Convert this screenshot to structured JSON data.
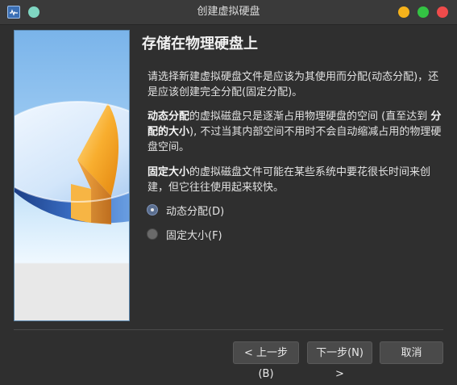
{
  "window": {
    "title": "创建虚拟硬盘"
  },
  "page": {
    "heading": "存储在物理硬盘上",
    "paragraph1": "请选择新建虚拟硬盘文件是应该为其使用而分配(动态分配)，还是应该创建完全分配(固定分配)。",
    "paragraph2": {
      "bold1": "动态分配",
      "text1": "的虚拟磁盘只是逐渐占用物理硬盘的空间 (直至达到 ",
      "bold2": "分配的大小",
      "text2": "), 不过当其内部空间不用时不会自动缩减占用的物理硬盘空间。"
    },
    "paragraph3": {
      "bold1": "固定大小",
      "text1": "的虚拟磁盘文件可能在某些系统中要花很长时间来创建，但它往往使用起来较快。"
    },
    "options": [
      {
        "label": "动态分配(D)",
        "selected": true
      },
      {
        "label": "固定大小(F)",
        "selected": false
      }
    ]
  },
  "buttons": {
    "back": "< 上一步(B)",
    "next": "下一步(N) >",
    "cancel": "取消"
  },
  "colors": {
    "window_bg": "#2f2f2f",
    "titlebar_bg": "#3a3a3a",
    "minimize": "#f5b21b",
    "maximize": "#33c343",
    "close": "#ef4b4b",
    "pin": "#7fd6c2"
  },
  "icons": {
    "app": "virtualbox-monitor-icon",
    "banner": "hard-disk-illustration"
  }
}
